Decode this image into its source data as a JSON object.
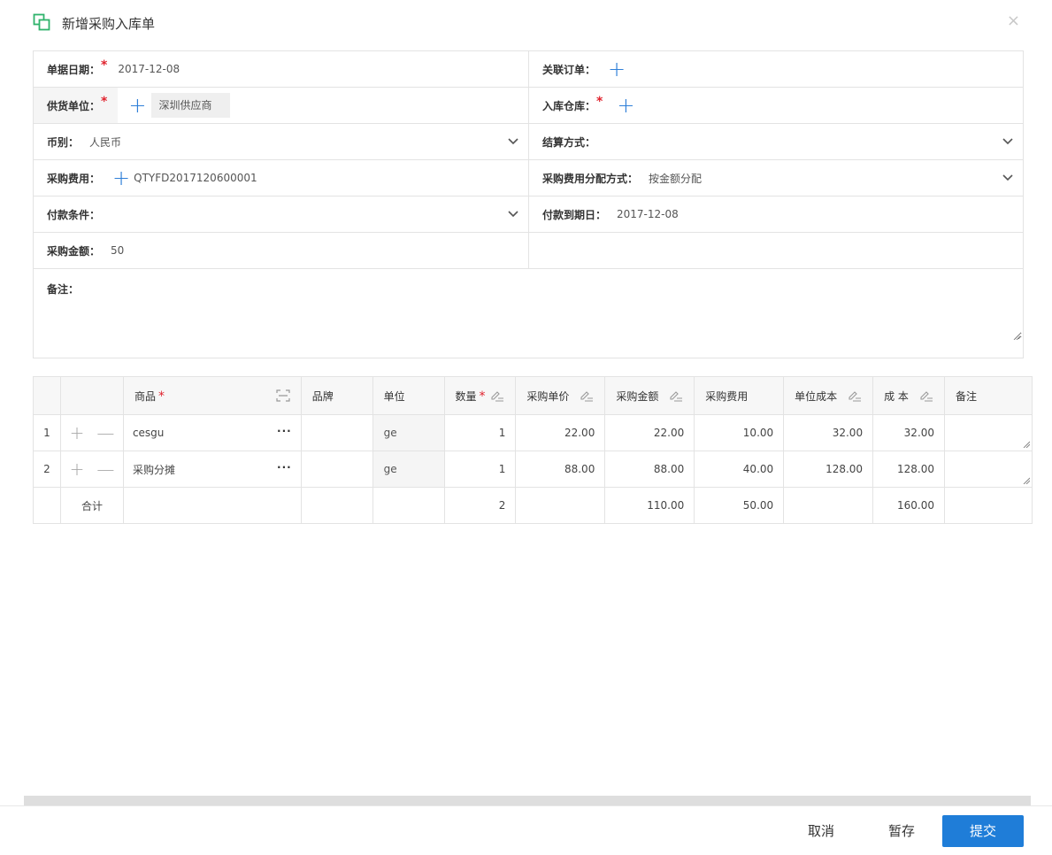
{
  "dialog": {
    "title": "新增采购入库单",
    "close_label": "×"
  },
  "form": {
    "doc_date": {
      "label": "单据日期：",
      "required": "*",
      "value": "2017-12-08"
    },
    "related_order": {
      "label": "关联订单："
    },
    "supplier": {
      "label": "供货单位：",
      "required": "*",
      "value": "深圳供应商"
    },
    "warehouse": {
      "label": "入库仓库：",
      "required": "*"
    },
    "currency": {
      "label": "币别：",
      "value": "人民币"
    },
    "settlement": {
      "label": "结算方式："
    },
    "purchase_fee": {
      "label": "采购费用：",
      "value": "QTYFD2017120600001"
    },
    "fee_allocation": {
      "label": "采购费用分配方式：",
      "value": "按金额分配"
    },
    "payment_terms": {
      "label": "付款条件："
    },
    "due_date": {
      "label": "付款到期日：",
      "value": "2017-12-08"
    },
    "amount": {
      "label": "采购金额：",
      "value": "50"
    },
    "remark": {
      "label": "备注："
    }
  },
  "table": {
    "headers": {
      "product": "商品",
      "product_req": "*",
      "brand": "品牌",
      "unit": "单位",
      "qty": "数量",
      "qty_req": "*",
      "price": "采购单价",
      "amount": "采购金额",
      "fee": "采购费用",
      "unit_cost": "单位成本",
      "cost": "成 本",
      "remark": "备注"
    },
    "rows": [
      {
        "idx": "1",
        "product": "cesgu",
        "brand": "",
        "unit": "ge",
        "qty": "1",
        "price": "22.00",
        "amount": "22.00",
        "fee": "10.00",
        "unit_cost": "32.00",
        "cost": "32.00"
      },
      {
        "idx": "2",
        "product": "采购分摊",
        "brand": "",
        "unit": "ge",
        "qty": "1",
        "price": "88.00",
        "amount": "88.00",
        "fee": "40.00",
        "unit_cost": "128.00",
        "cost": "128.00"
      }
    ],
    "total": {
      "label": "合计",
      "qty": "2",
      "amount": "110.00",
      "fee": "50.00",
      "cost": "160.00"
    },
    "row_add": "+",
    "row_remove": "—",
    "more": "···"
  },
  "footer": {
    "cancel": "取消",
    "draft": "暂存",
    "submit": "提交"
  },
  "colors": {
    "accent": "#1f7dd8",
    "required": "#e0232e",
    "logo": "#2fb36b"
  }
}
